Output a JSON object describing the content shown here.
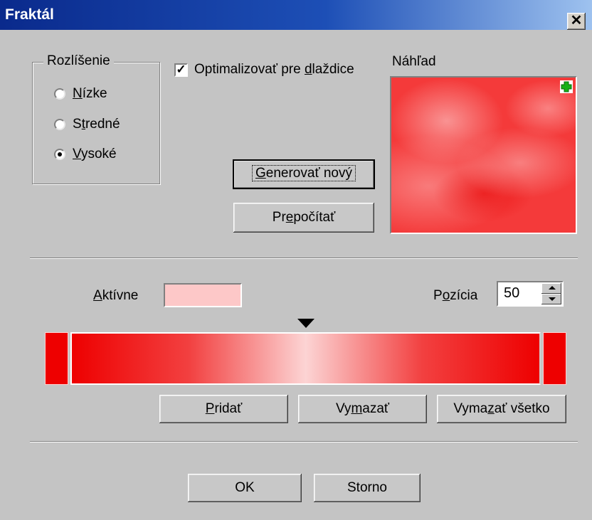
{
  "window": {
    "title": "Fraktál",
    "close_glyph": "✕"
  },
  "resolution": {
    "legend": "Rozlíšenie",
    "options": [
      {
        "hotkey": "N",
        "rest": "ízke",
        "selected": false
      },
      {
        "pre": "S",
        "hotkey": "t",
        "rest": "redné",
        "selected": false
      },
      {
        "hotkey": "V",
        "rest": "ysoké",
        "selected": true
      }
    ]
  },
  "optimize_tiles": {
    "checked": true,
    "mark": "✓",
    "pre": "Optimalizovať pre ",
    "hotkey": "d",
    "rest": "laždice"
  },
  "preview": {
    "label": "Náhľad",
    "icon": "plus-icon"
  },
  "buttons": {
    "generate": {
      "hotkey": "G",
      "rest": "enerovať nový"
    },
    "recalc": {
      "pre": "Pr",
      "hotkey": "e",
      "rest": "počítať"
    },
    "add": {
      "hotkey": "P",
      "rest": "ridať"
    },
    "delete": {
      "pre": "Vy",
      "hotkey": "m",
      "rest": "azať"
    },
    "delete_all": {
      "pre": "Vyma",
      "hotkey": "z",
      "rest": "ať všetko"
    },
    "ok": "OK",
    "cancel": "Storno"
  },
  "active": {
    "hotkey": "A",
    "rest": "ktívne",
    "color": "#fdc8c8"
  },
  "position": {
    "pre": "P",
    "hotkey": "o",
    "rest": "zícia",
    "value": "50"
  },
  "gradient": {
    "start_color": "#ee0000",
    "mid_color": "#fcd4d4",
    "end_color": "#ee0000",
    "marker_position": 0.5
  }
}
